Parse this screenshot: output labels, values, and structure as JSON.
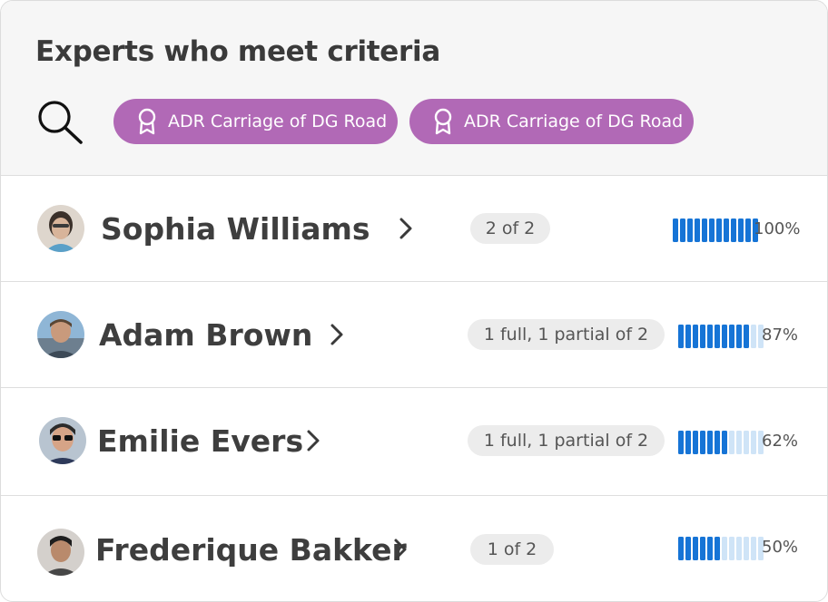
{
  "title": "Experts who meet criteria",
  "colors": {
    "header_bg": "#f6f6f6",
    "chip_bg": "#b169b6",
    "meter_on": "#1674d6",
    "meter_off": "#cfe4f7",
    "badge_bg": "#ececec"
  },
  "filters": [
    {
      "label": "ADR Carriage of DG Road",
      "icon": "award-ribbon-icon"
    },
    {
      "label": "ADR Carriage of DG Road",
      "icon": "award-ribbon-icon"
    }
  ],
  "experts": [
    {
      "name": "Sophia Williams",
      "match": "2 of 2",
      "percent_label": "100%",
      "percent": 100
    },
    {
      "name": "Adam Brown",
      "match": "1 full, 1 partial of 2",
      "percent_label": "87%",
      "percent": 87
    },
    {
      "name": "Emilie Evers",
      "match": "1 full, 1 partial of 2",
      "percent_label": "62%",
      "percent": 62
    },
    {
      "name": "Frederique Bakker",
      "match": "1 of 2",
      "percent_label": "50%",
      "percent": 50
    }
  ]
}
